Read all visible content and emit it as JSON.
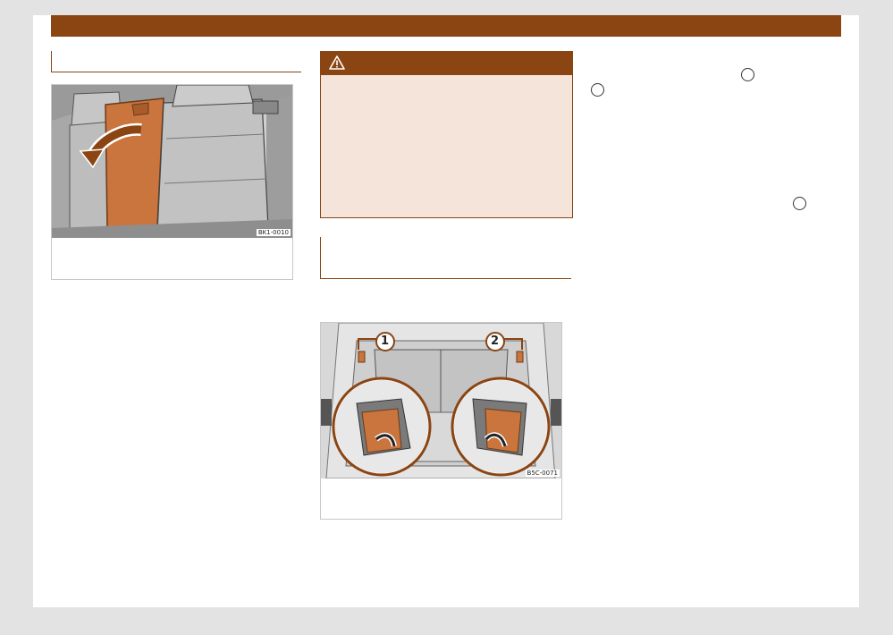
{
  "figure_1": {
    "code": "BK1-0010"
  },
  "figure_2": {
    "code": "B5C-0071",
    "callouts": [
      "1",
      "2"
    ]
  },
  "warning": {
    "icon": "warning-triangle-icon"
  },
  "colors": {
    "accent": "#8a4513",
    "warning_bg": "#f5e4d9",
    "figure_orange": "#c9753d"
  }
}
